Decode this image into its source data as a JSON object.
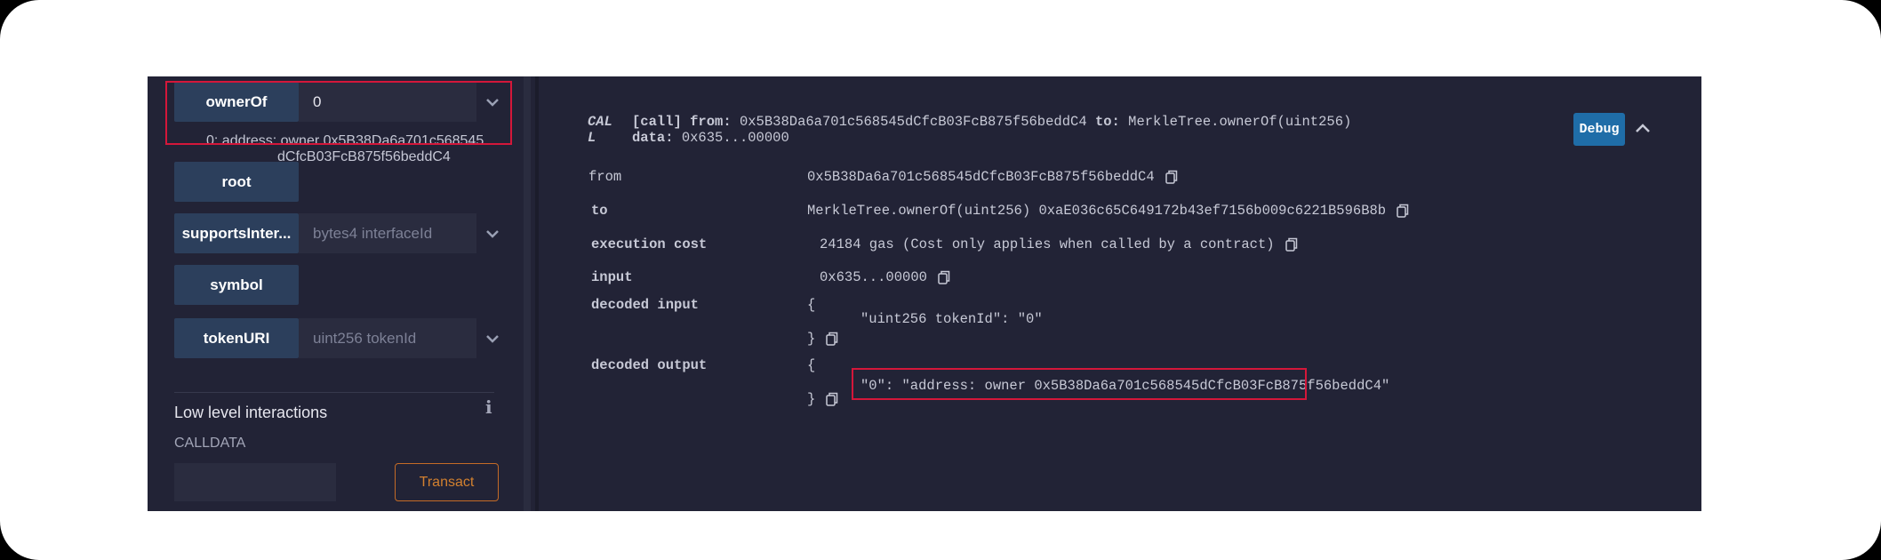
{
  "left_panel": {
    "functions": [
      {
        "label": "ownerOf",
        "input_value": "0",
        "has_chevron": true
      },
      {
        "label": "root"
      },
      {
        "label": "supportsInter...",
        "input_placeholder": "bytes4 interfaceId",
        "has_chevron": true
      },
      {
        "label": "symbol"
      },
      {
        "label": "tokenURI",
        "input_placeholder": "uint256 tokenId",
        "has_chevron": true
      }
    ],
    "owner_result_line1": "0:  address: owner 0x5B38Da6a701c568545",
    "owner_result_line2": "dCfcB03FcB875f56beddC4",
    "low_level_title": "Low level interactions",
    "info_icon_glyph": "i",
    "calldata_label": "CALLDATA",
    "transact_label": "Transact"
  },
  "right_panel": {
    "call_tag_line1": "CAL",
    "call_tag_line2": "L",
    "call_bracket": "[call]",
    "from_kw": "from:",
    "from_addr": "0x5B38Da6a701c568545dCfcB03FcB875f56beddC4",
    "to_kw": "to:",
    "to_fn": "MerkleTree.ownerOf(uint256)",
    "data_kw": "data:",
    "data_val": "0x635...00000",
    "debug_label": "Debug",
    "rows": {
      "from": {
        "key": "from",
        "value": "0x5B38Da6a701c568545dCfcB03FcB875f56beddC4"
      },
      "to": {
        "key": "to",
        "value": "MerkleTree.ownerOf(uint256) 0xaE036c65C649172b43ef7156b009c6221B596B8b"
      },
      "execution_cost": {
        "key": "execution cost",
        "value": "24184 gas (Cost only applies when called by a contract)"
      },
      "input": {
        "key": "input",
        "value": "0x635...00000"
      },
      "decoded_input": {
        "key": "decoded input",
        "open": "{",
        "body": "\"uint256 tokenId\": \"0\"",
        "close": "}"
      },
      "decoded_output": {
        "key": "decoded output",
        "open": "{",
        "body": "\"0\": \"address: owner 0x5B38Da6a701c568545dCfcB03FcB875f56beddC4\"",
        "close": "}"
      }
    }
  },
  "colors": {
    "background": "#222336",
    "button": "#2c3f5c",
    "highlight": "#d4173a",
    "debug": "#1f6da8",
    "transact": "#d2802f"
  }
}
